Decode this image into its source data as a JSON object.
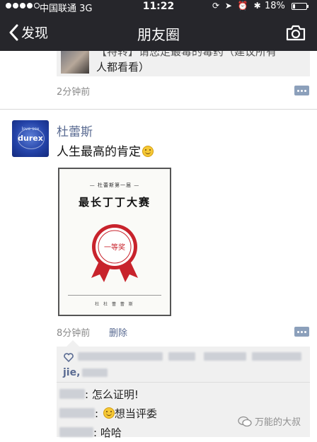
{
  "status_bar": {
    "carrier": "中国联通",
    "network": "3G",
    "time": "11:22",
    "battery_percent": "18%",
    "battery_level": 0.18,
    "signal_bars_filled": 4,
    "signal_bars_total": 5
  },
  "nav": {
    "back_label": "发现",
    "title": "朋友圈",
    "camera_icon": "camera-icon"
  },
  "feed": {
    "prev_post": {
      "link_line1": "【特转】请您走最毒的毒药（建议所有",
      "link_line2": "人都看看）",
      "time": "2分钟前"
    },
    "post": {
      "author": "杜蕾斯",
      "avatar_text": "durex",
      "avatar_tagline": "love sex",
      "text": "人生最高的肯定",
      "certificate": {
        "subtitle": "— 杜蕾斯第一届 —",
        "title": "最长丁丁大赛",
        "seal_text": "一等奖",
        "signature": "杜 杜 蕾 蕾 斯"
      },
      "time": "8分钟前",
      "delete_label": "删除",
      "likes_visible_text": "jie,",
      "comments": [
        {
          "text": ": 怎么证明!"
        },
        {
          "text": ": 想当评委",
          "has_emoji": true
        },
        {
          "text": ": 哈哈"
        }
      ]
    }
  },
  "watermark": {
    "text": "万能的大叔",
    "icon": "wechat-icon"
  },
  "colors": {
    "nav_bg": "#26262b",
    "link_blue": "#5a6b92",
    "more_button": "#8ca0bb",
    "comment_bg": "#f0f0f0"
  }
}
